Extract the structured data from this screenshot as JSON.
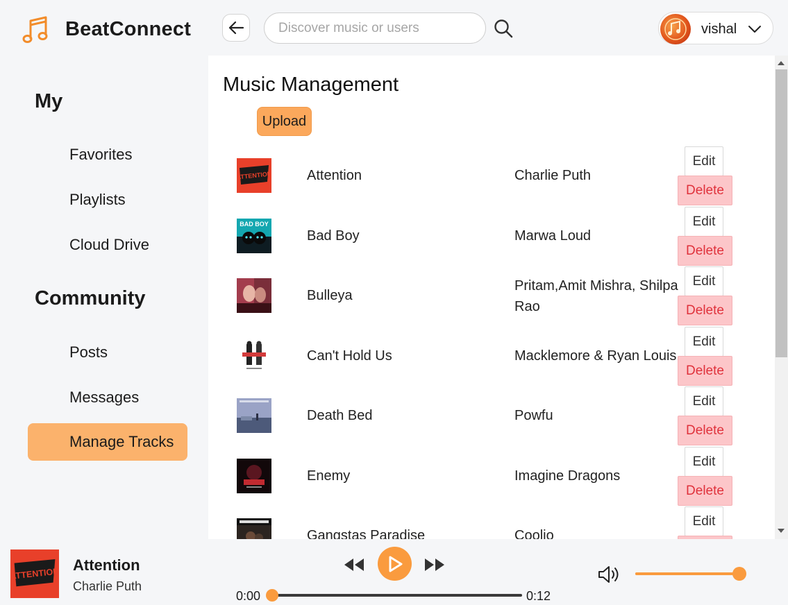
{
  "brand": {
    "name": "BeatConnect"
  },
  "search": {
    "placeholder": "Discover music or users"
  },
  "user": {
    "name": "vishal"
  },
  "sidebar": {
    "my_title": "My",
    "my_items": [
      {
        "label": "Favorites"
      },
      {
        "label": "Playlists"
      },
      {
        "label": "Cloud Drive"
      }
    ],
    "community_title": "Community",
    "community_items": [
      {
        "label": "Posts"
      },
      {
        "label": "Messages"
      },
      {
        "label": "Manage Tracks",
        "active": true
      }
    ]
  },
  "main": {
    "title": "Music Management",
    "upload_label": "Upload",
    "edit_label": "Edit",
    "delete_label": "Delete",
    "tracks": [
      {
        "title": "Attention",
        "artist": "Charlie Puth",
        "cover": "attention-cover"
      },
      {
        "title": "Bad Boy",
        "artist": "Marwa Loud",
        "cover": "bad-boy-cover"
      },
      {
        "title": "Bulleya",
        "artist": "Pritam,Amit Mishra, Shilpa Rao",
        "cover": "bulleya-cover"
      },
      {
        "title": "Can't Hold Us",
        "artist": "Macklemore & Ryan Louis",
        "cover": "cant-hold-us-cover"
      },
      {
        "title": "Death Bed",
        "artist": "Powfu",
        "cover": "death-bed-cover"
      },
      {
        "title": "Enemy",
        "artist": "Imagine Dragons",
        "cover": "enemy-cover"
      },
      {
        "title": "Gangstas Paradise",
        "artist": "Coolio",
        "cover": "gangstas-paradise-cover"
      }
    ]
  },
  "player": {
    "title": "Attention",
    "artist": "Charlie Puth",
    "current_time": "0:00",
    "total_time": "0:12",
    "progress": 0,
    "volume": 1.0
  },
  "colors": {
    "accent": "#fa9b3e",
    "active_nav": "#fbb26c",
    "delete_bg": "#fcc6c9",
    "delete_text": "#e0323c"
  }
}
